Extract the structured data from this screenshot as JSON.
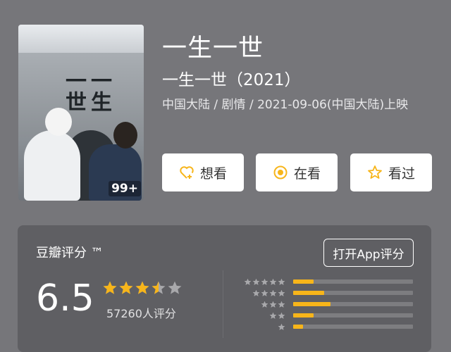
{
  "movie": {
    "title": "一生一世",
    "subtitle": "一生一世（2021）",
    "meta": "中国大陆 / 剧情 / 2021-09-06(中国大陆)上映",
    "poster_badge": "99+"
  },
  "actions": [
    {
      "label": "想看",
      "icon": "heart-plus-icon"
    },
    {
      "label": "在看",
      "icon": "circle-dot-icon"
    },
    {
      "label": "看过",
      "icon": "star-outline-icon"
    }
  ],
  "rating": {
    "label": "豆瓣评分 ™",
    "open_app": "打开App评分",
    "score": "6.5",
    "stars": 3.5,
    "count": "57260人评分",
    "distribution": [
      {
        "stars": 5,
        "fraction": 0.17
      },
      {
        "stars": 4,
        "fraction": 0.26
      },
      {
        "stars": 3,
        "fraction": 0.31
      },
      {
        "stars": 2,
        "fraction": 0.17
      },
      {
        "stars": 1,
        "fraction": 0.08
      }
    ]
  },
  "colors": {
    "accent": "#f7b51a",
    "page": "#76767a",
    "panel": "#5f5f63"
  }
}
